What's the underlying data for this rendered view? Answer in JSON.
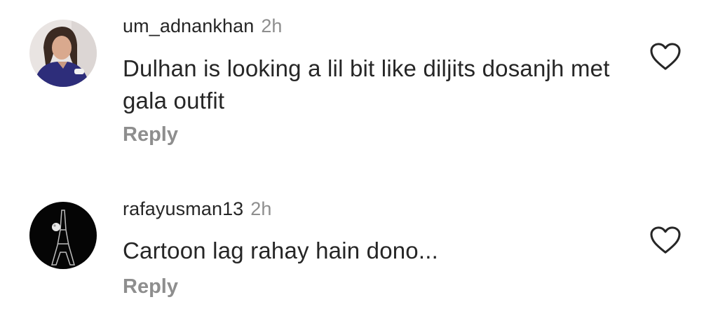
{
  "comments": [
    {
      "username": "um_adnankhan",
      "time": "2h",
      "text": "Dulhan is looking a lil bit like diljits dosanjh met gala outfit",
      "reply_label": "Reply",
      "like_icon": "heart-outline-icon"
    },
    {
      "username": "rafayusman13",
      "time": "2h",
      "text": "Cartoon lag rahay hain dono...",
      "reply_label": "Reply",
      "like_icon": "heart-outline-icon"
    }
  ],
  "colors": {
    "text": "#262626",
    "muted": "#8e8e8e",
    "background": "#ffffff"
  }
}
